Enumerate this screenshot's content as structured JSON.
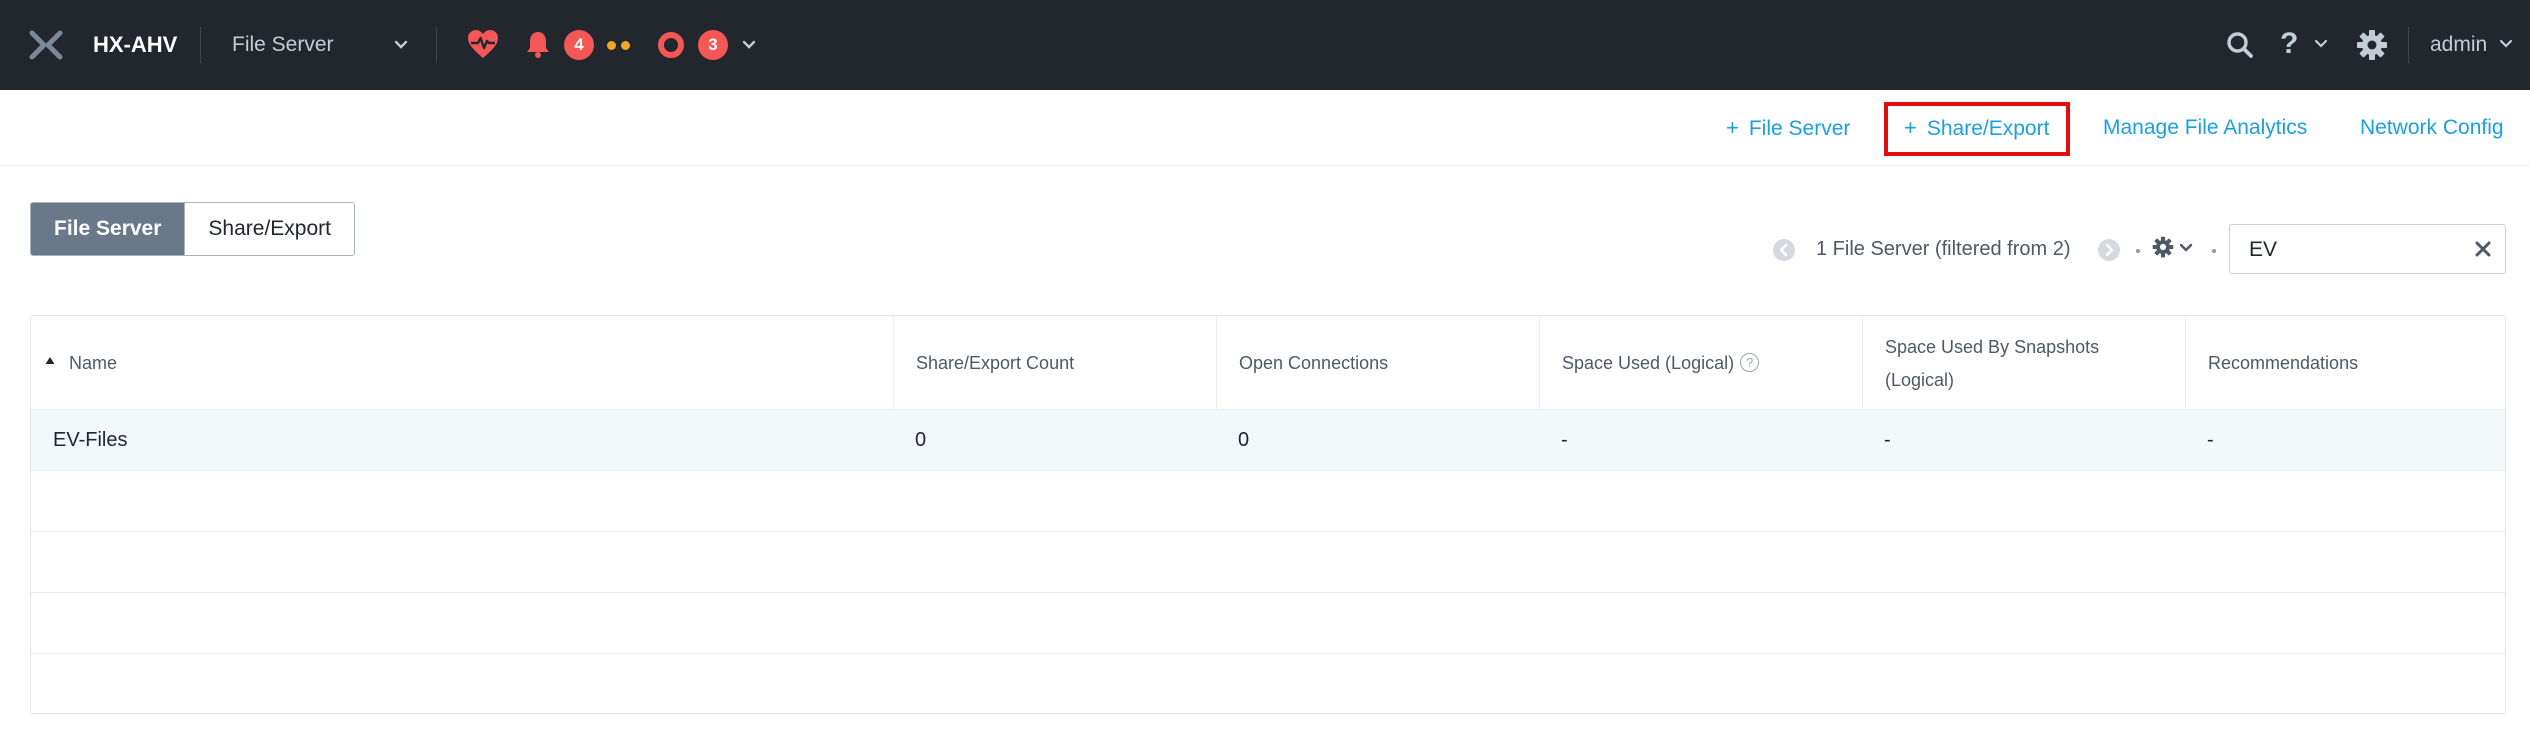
{
  "topbar": {
    "cluster_name": "HX-AHV",
    "entity_label": "File Server",
    "alerts_count": "4",
    "events_count": "3",
    "help_label": "?",
    "user_label": "admin"
  },
  "actions": {
    "add_file_server": "File Server",
    "add_share_export": "Share/Export",
    "plus_symbol": "+",
    "manage_file_analytics": "Manage File Analytics",
    "network_config": "Network Config"
  },
  "view_toggle": {
    "file_server": "File Server",
    "share_export": "Share/Export",
    "active": "File Server"
  },
  "pagination": {
    "summary": "1 File Server (filtered from 2)"
  },
  "filter": {
    "value": "EV"
  },
  "table": {
    "columns": [
      "Name",
      "Share/Export Count",
      "Open Connections",
      "Space Used (Logical)",
      "Space Used By Snapshots (Logical)",
      "Recommendations"
    ],
    "rows": [
      [
        "EV-Files",
        "0",
        "0",
        "-",
        "-",
        "-"
      ]
    ]
  },
  "colors": {
    "topbar_bg": "#22272e",
    "accent_link": "#1b9fe0",
    "badge_red": "#f55656",
    "highlight_red": "#e00e0e",
    "toggle_active": "#6a7889",
    "selected_row": "#f3f8fb"
  },
  "icons": {
    "logo": "nutanix-x-logo",
    "health": "heart-pulse-icon",
    "alerts": "bell-icon",
    "events": "ring-icon",
    "search": "search-icon",
    "settings": "gear-icon",
    "clear": "close-icon",
    "info": "question-circle-icon"
  }
}
